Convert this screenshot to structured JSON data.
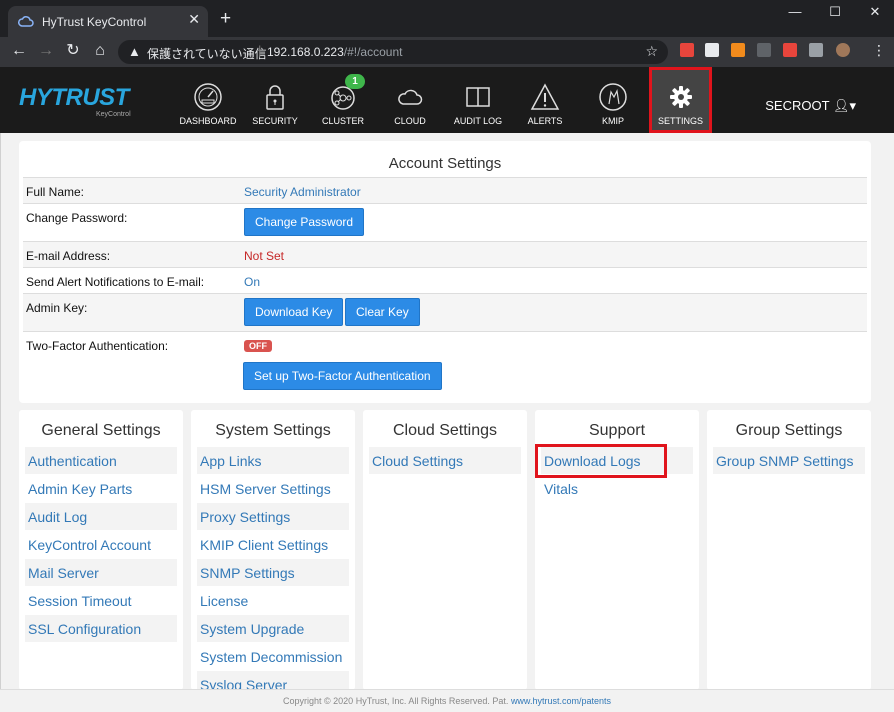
{
  "browser": {
    "tab_title": "HyTrust KeyControl",
    "tab_close": "✕",
    "new_tab": "+",
    "url_warning": "保護されていない通信",
    "url_host": "192.168.0.223",
    "url_path": "/#!/account"
  },
  "app": {
    "logo": "HYTRUST",
    "logo_sub": "KeyControl",
    "nav": [
      {
        "label": "DASHBOARD",
        "icon": "dashboard-icon"
      },
      {
        "label": "SECURITY",
        "icon": "lock-icon"
      },
      {
        "label": "CLUSTER",
        "icon": "cluster-icon",
        "badge": "1"
      },
      {
        "label": "CLOUD",
        "icon": "cloud-icon"
      },
      {
        "label": "AUDIT LOG",
        "icon": "book-icon"
      },
      {
        "label": "ALERTS",
        "icon": "alert-icon"
      },
      {
        "label": "KMIP",
        "icon": "kmip-icon"
      },
      {
        "label": "SETTINGS",
        "icon": "gear-icon"
      }
    ],
    "user": "SECROOT"
  },
  "account": {
    "title": "Account Settings",
    "full_name_label": "Full Name:",
    "full_name": "Security Administrator",
    "change_password_label": "Change Password:",
    "change_password_button": "Change Password",
    "email_label": "E-mail Address:",
    "email": "Not Set",
    "alerts_label": "Send Alert Notifications to E-mail:",
    "alerts_value": "On",
    "admin_key_label": "Admin Key:",
    "download_key_button": "Download Key",
    "clear_key_button": "Clear Key",
    "two_factor_label": "Two-Factor Authentication:",
    "two_factor_status": "OFF",
    "two_factor_button": "Set up Two-Factor Authentication"
  },
  "panels": [
    {
      "title": "General Settings",
      "items": [
        "Authentication",
        "Admin Key Parts",
        "Audit Log",
        "KeyControl Account",
        "Mail Server",
        "Session Timeout",
        "SSL Configuration"
      ]
    },
    {
      "title": "System Settings",
      "items": [
        "App Links",
        "HSM Server Settings",
        "Proxy Settings",
        "KMIP Client Settings",
        "SNMP Settings",
        "License",
        "System Upgrade",
        "System Decommission",
        "Syslog Server"
      ]
    },
    {
      "title": "Cloud Settings",
      "items": [
        "Cloud Settings"
      ]
    },
    {
      "title": "Support",
      "items": [
        "Download Logs",
        "Vitals"
      ]
    },
    {
      "title": "Group Settings",
      "items": [
        "Group SNMP Settings"
      ]
    }
  ],
  "footer": {
    "text": "Copyright © 2020 HyTrust, Inc. All Rights Reserved. Pat.",
    "link": "www.hytrust.com/patents"
  },
  "colors": {
    "brand_blue": "#29a6de",
    "button_blue": "#2c8be6",
    "highlight_red": "#e0141c",
    "header_bg": "#1b1b1b"
  }
}
